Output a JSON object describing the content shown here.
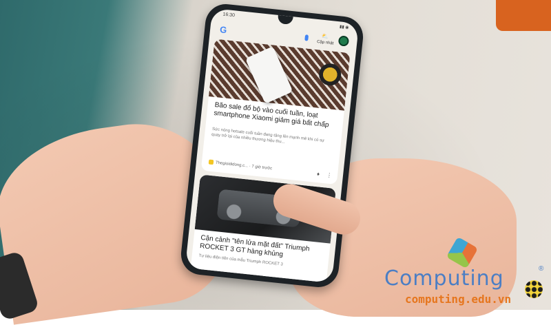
{
  "status_bar": {
    "time": "16:30"
  },
  "google_bar": {
    "logo": "G",
    "update_label": "Cập nhật"
  },
  "cards": [
    {
      "title": "Bão sale đổ bộ vào cuối tuần, loạt smartphone Xiaomi giảm giá bất chấp",
      "snippet": "Sức nóng hotsale cuối tuần đang tăng lên mạnh mẽ khi có sự quay trở lại của nhiều thương hiệu thu...",
      "source": "Thegioididong.c...",
      "time": "7 giờ trước"
    },
    {
      "title": "Cận cảnh \"tên lửa mặt đất\" Triumph ROCKET 3 GT hàng khủng",
      "snippet": "Tư liệu điện tiên của mẫu Triumph ROCKET 3"
    }
  ],
  "watermark": {
    "name": "Computing",
    "reg": "®",
    "url": "computing.edu.vn"
  }
}
